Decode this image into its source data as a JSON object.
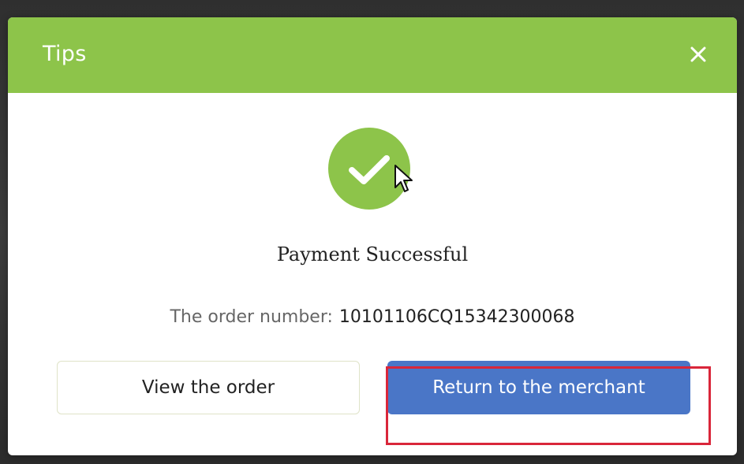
{
  "dialog": {
    "title": "Tips",
    "close_icon": "close-icon",
    "success_icon": "checkmark-circle-icon",
    "status_text": "Payment Successful",
    "order_label": "The order number:",
    "order_number": "10101106CQ15342300068",
    "view_order_label": "View the order",
    "return_label": "Return to the merchant"
  },
  "colors": {
    "header": "#8dc44a",
    "success": "#8dc44a",
    "primary_button": "#4a76c7",
    "highlight": "#d9263a"
  }
}
